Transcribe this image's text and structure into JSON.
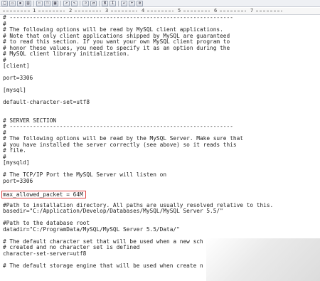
{
  "toolbar": {
    "buttons": [
      "new-icon",
      "open-icon",
      "save-icon",
      "print-icon",
      "cut-icon",
      "copy-icon",
      "paste-icon",
      "undo-icon",
      "redo-icon",
      "find-icon",
      "replace-icon",
      "bold-icon",
      "italic-icon",
      "wrap-icon",
      "zoom-icon",
      "settings-icon"
    ]
  },
  "ruler": {
    "numbers": [
      "1",
      "2",
      "3",
      "4",
      "5",
      "6",
      "7"
    ]
  },
  "editor": {
    "lines": [
      "# -------------------------------------------------------------------",
      "#",
      "# The following options will be read by MySQL client applications.",
      "# Note that only client applications shipped by MySQL are guaranteed",
      "# to read this section. If you want your own MySQL client program to",
      "# honor these values, you need to specify it as an option during the",
      "# MySQL client library initialization.",
      "#",
      "[client]",
      "",
      "port=3306",
      "",
      "[mysql]",
      "",
      "default-character-set=utf8",
      "",
      "",
      "# SERVER SECTION",
      "# -------------------------------------------------------------------",
      "#",
      "# The following options will be read by the MySQL Server. Make sure that",
      "# you have installed the server correctly (see above) so it reads this",
      "# file.",
      "#",
      "[mysqld]",
      "",
      "# The TCP/IP Port the MySQL Server will listen on",
      "port=3306",
      "",
      "max_allowed_packet = 64M",
      "",
      "#Path to installation directory. All paths are usually resolved relative to this.",
      "basedir=\"C:/Application/Develop/Databases/MySQL/MySQL Server 5.5/\"",
      "",
      "#Path to the database root",
      "datadir=\"C:/ProgramData/MySQL/MySQL Server 5.5/Data/\"",
      "",
      "# The default character set that will be used when a new sch",
      "# created and no character set is defined",
      "character-set-server=utf8",
      "",
      "# The default storage engine that will be used when create n"
    ],
    "highlighted_line": 29
  }
}
